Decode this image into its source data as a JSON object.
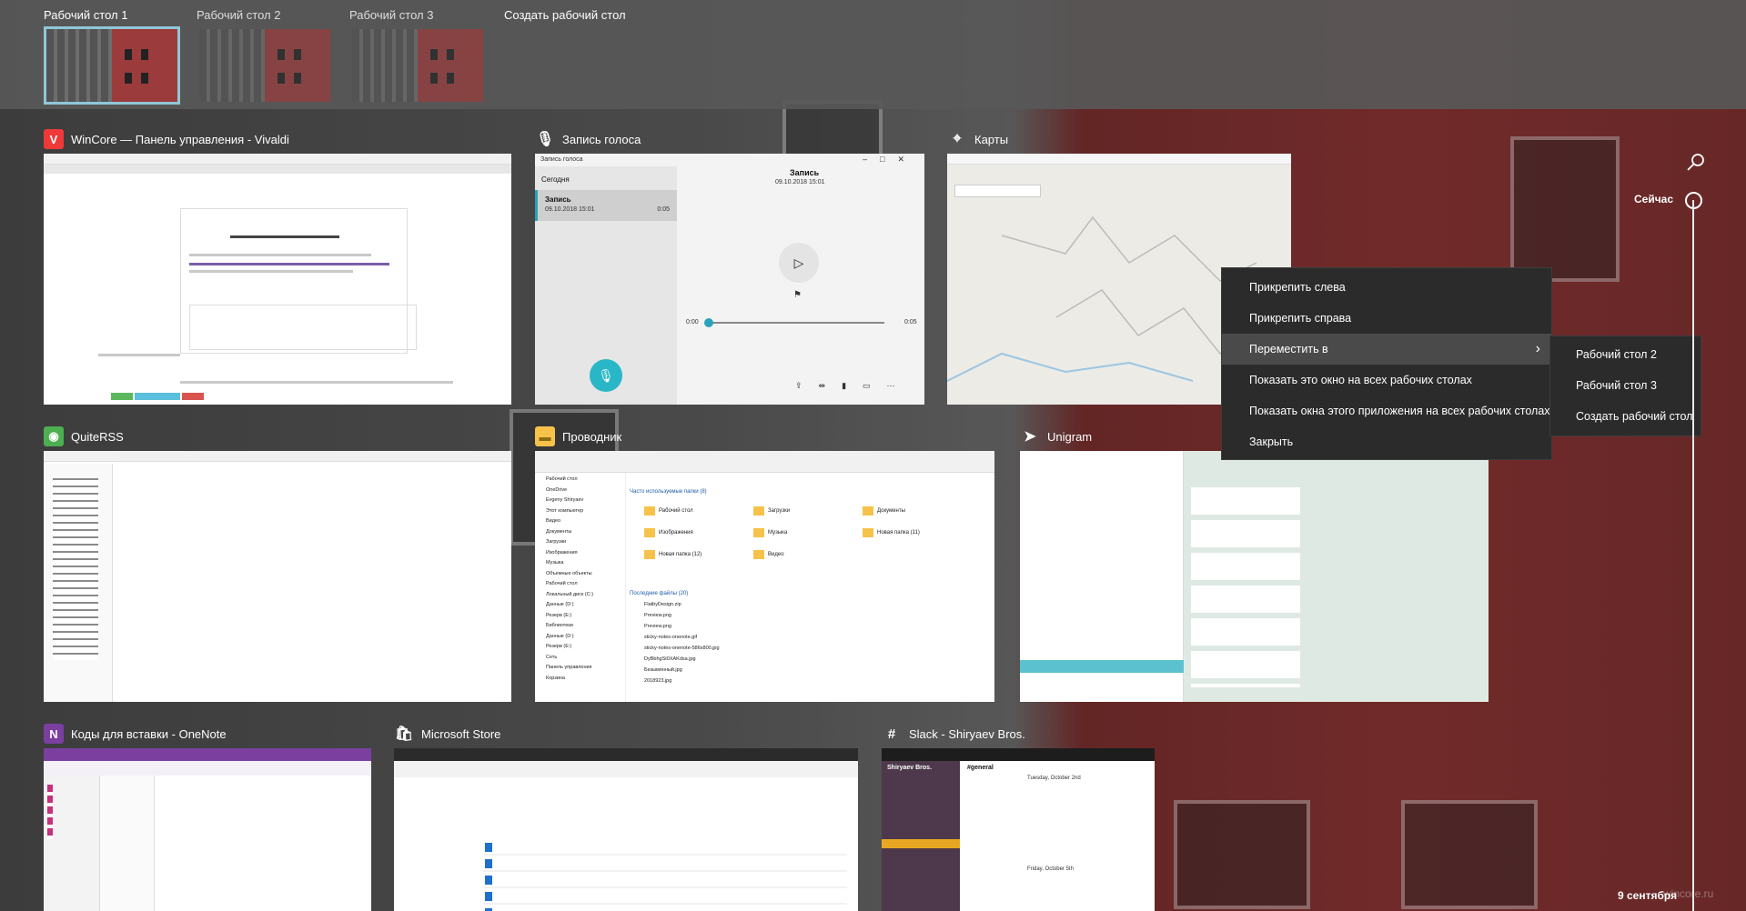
{
  "desktops": {
    "items": [
      {
        "label": "Рабочий стол 1",
        "active": true
      },
      {
        "label": "Рабочий стол 2",
        "active": false
      },
      {
        "label": "Рабочий стол 3",
        "active": false
      }
    ],
    "new_desktop": "Создать рабочий стол"
  },
  "windows": [
    {
      "title": "WinCore — Панель управления - Vivaldi",
      "icon": "vivaldi-icon",
      "color": "#ef3939",
      "glyph": "V"
    },
    {
      "title": "Запись голоса",
      "icon": "voice-recorder-icon",
      "color": "#ffffff",
      "glyph": "🎙"
    },
    {
      "title": "Карты",
      "icon": "maps-icon",
      "color": "#ffffff",
      "glyph": "⌖"
    },
    {
      "title": "QuiteRSS",
      "icon": "quiterss-icon",
      "color": "#4caf50",
      "glyph": "◉"
    },
    {
      "title": "Проводник",
      "icon": "file-explorer-icon",
      "color": "#f6c24a",
      "glyph": "▬"
    },
    {
      "title": "Unigram",
      "icon": "unigram-icon",
      "color": "#ffffff",
      "glyph": "➤"
    },
    {
      "title": "Коды для вставки - OneNote",
      "icon": "onenote-icon",
      "color": "#7b3fa0",
      "glyph": "N"
    },
    {
      "title": "Microsoft Store",
      "icon": "microsoft-store-icon",
      "color": "#ffffff",
      "glyph": "🛍"
    },
    {
      "title": "Slack - Shiryaev Bros.",
      "icon": "slack-icon",
      "color": "#ffffff",
      "glyph": "#"
    }
  ],
  "voice": {
    "app": "Запись голоса",
    "today": "Сегодня",
    "rec_name": "Запись",
    "rec_date": "09.10.2018 15:01",
    "rec_len": "0:05",
    "heading": "Запись",
    "heading_date": "09.10.2018 15:01",
    "time_start": "0:00",
    "time_end": "0:05"
  },
  "explorer": {
    "frequent": "Часто используемые папки (8)",
    "recent": "Последние файлы (20)",
    "sidebar": [
      "Рабочий стол",
      "OneDrive",
      "Evgeny Shiryaev",
      "Этот компьютер",
      "Видео",
      "Документы",
      "Загрузки",
      "Изображения",
      "Музыка",
      "Объемные объекты",
      "Рабочий стол",
      "Локальный диск (C:)",
      "Данные (D:)",
      "Резерв (E:)",
      "Библиотеки",
      "Данные (D:)",
      "Резерв (E:)",
      "Сеть",
      "Панель управления",
      "Корзина"
    ],
    "folders": [
      "Рабочий стол",
      "Загрузки",
      "Документы",
      "Изображения",
      "Музыка",
      "Новая папка (11)",
      "Новая папка (12)",
      "Видео"
    ],
    "files": [
      "FlatbyDesign.zip",
      "Preview.png",
      "Preview.png",
      "sticky-notes-onenote.gif",
      "sticky-notes-onenote-586x800.jpg",
      "DyBbhgSt0XAKdsa.jpg",
      "Безымянный.jpg",
      "2018923.jpg"
    ]
  },
  "context_menu": {
    "items": [
      "Прикрепить слева",
      "Прикрепить справа",
      "Переместить в",
      "Показать это окно на всех рабочих столах",
      "Показать окна этого приложения на всех рабочих столах",
      "Закрыть"
    ],
    "submenu": [
      "Рабочий стол 2",
      "Рабочий стол 3",
      "Создать рабочий стол"
    ]
  },
  "timeline": {
    "now": "Сейчас",
    "date": "9 сентября"
  },
  "slack": {
    "team": "Shiryaev Bros.",
    "channel": "#general",
    "day1": "Tuesday, October 2nd",
    "day2": "Friday, October 5th"
  },
  "watermark": "wincore.ru"
}
